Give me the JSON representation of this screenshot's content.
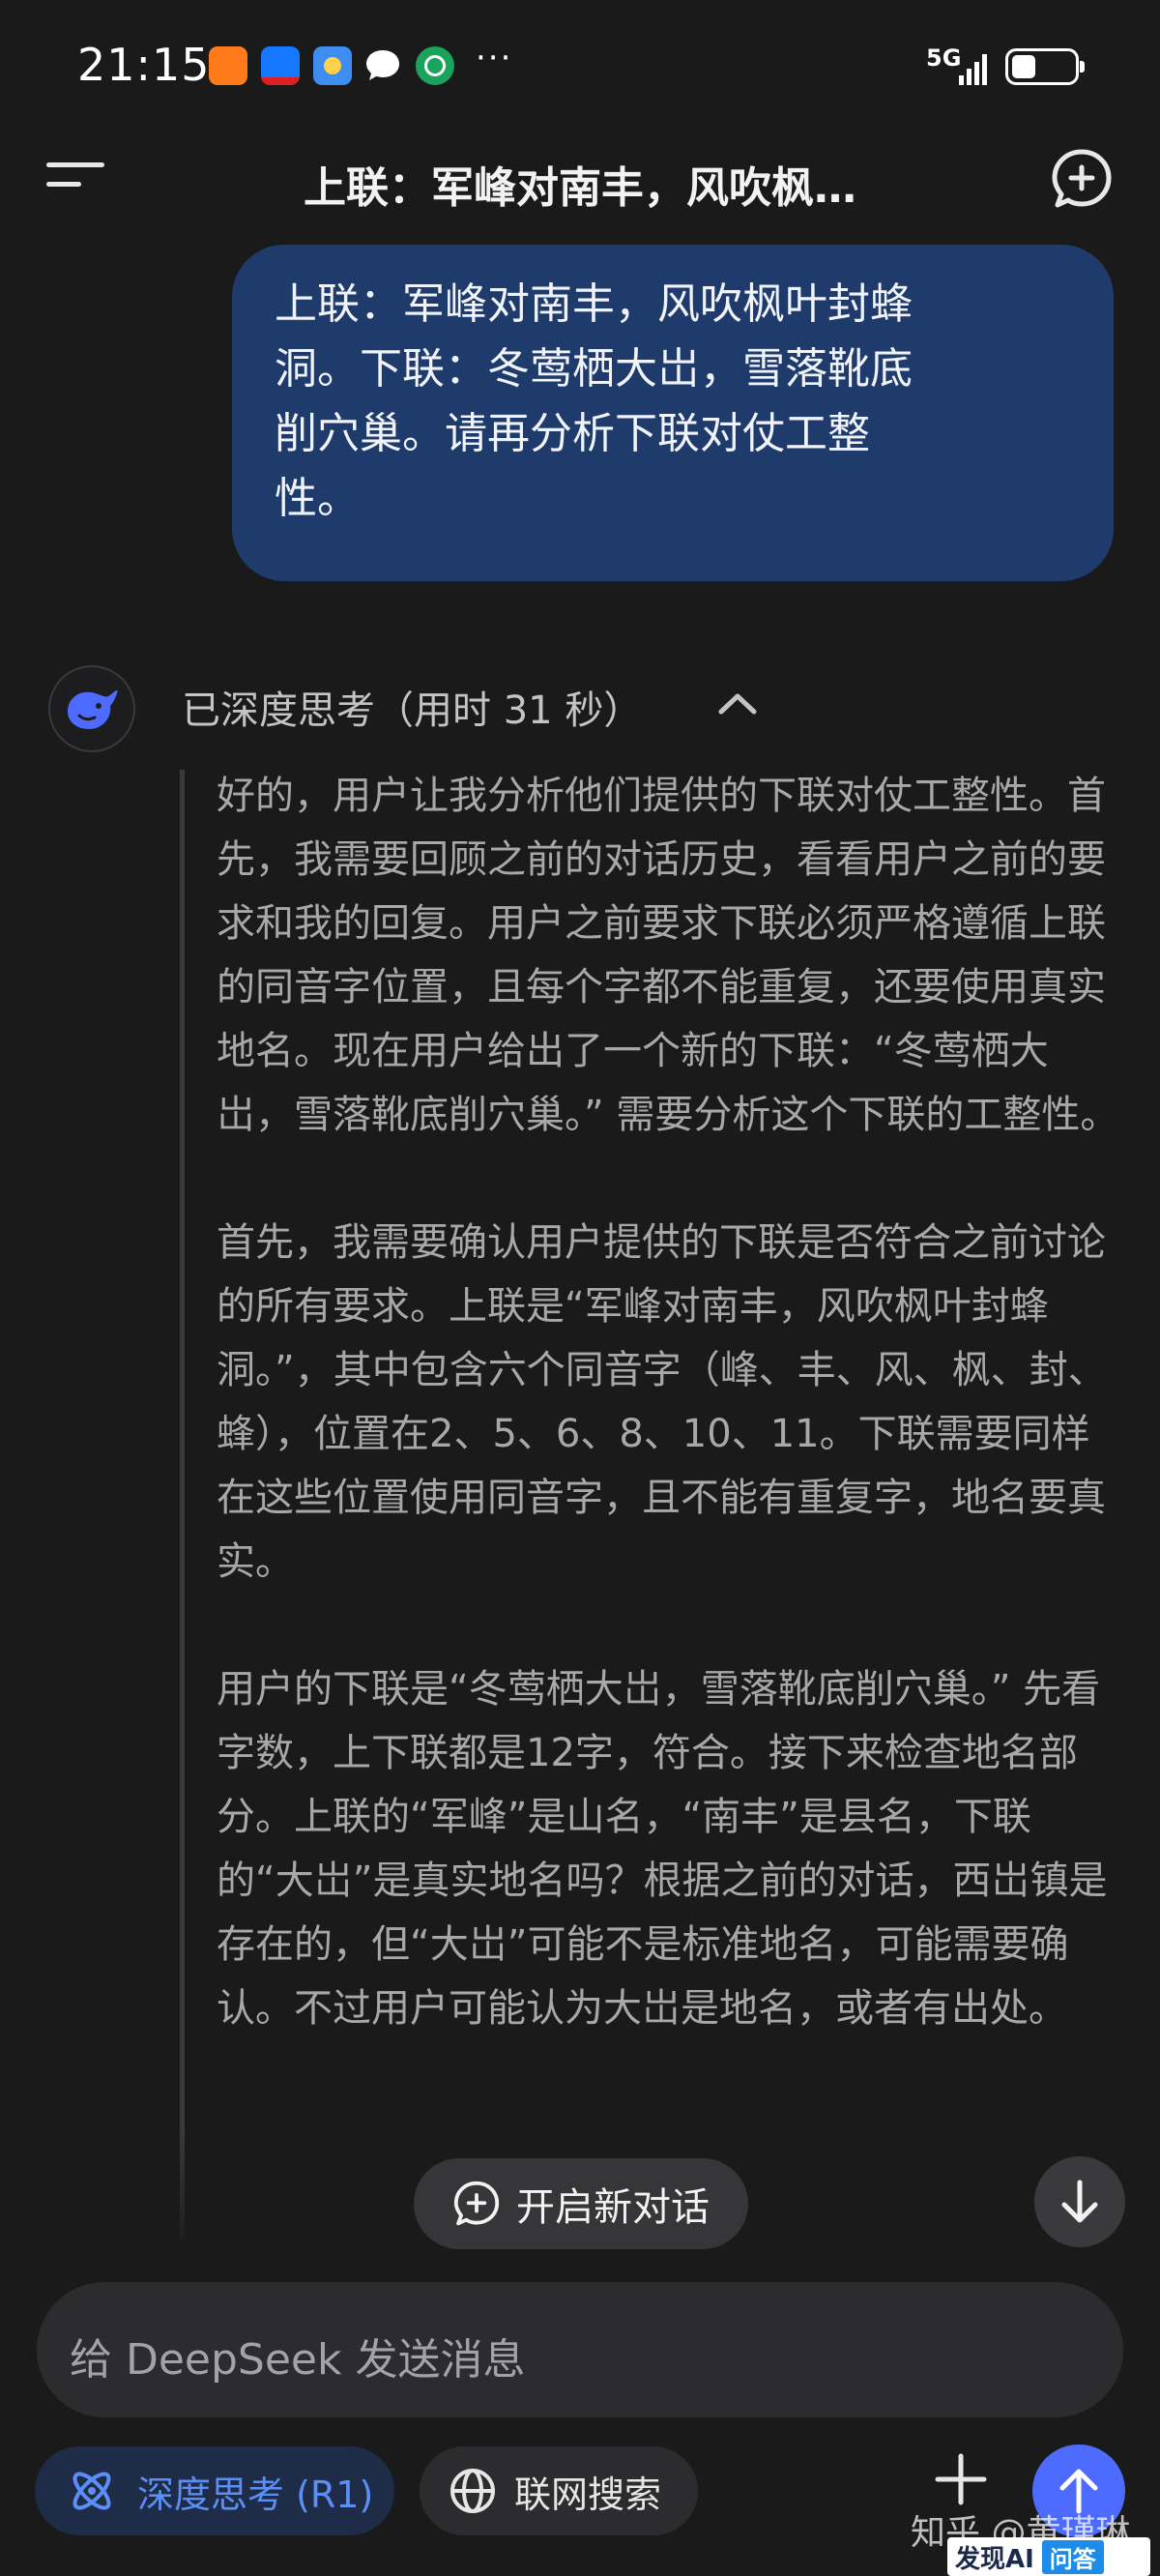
{
  "status_bar": {
    "time": "21:15",
    "network": "5G",
    "more": "···"
  },
  "header": {
    "title": "上联：军峰对南丰，风吹枫…"
  },
  "user_message": {
    "lines": [
      "上联：军峰对南丰，风吹枫叶封蜂",
      "洞。下联：冬莺栖大岀，雪落靴底",
      "削穴巢。请再分析下联对仗工整",
      "性。"
    ]
  },
  "ai": {
    "think_header": "已深度思考（用时 31 秒）",
    "thought_paragraphs": [
      "好的，用户让我分析他们提供的下联对仗工整性。首先，我需要回顾之前的对话历史，看看用户之前的要求和我的回复。用户之前要求下联必须严格遵循上联的同音字位置，且每个字都不能重复，还要使用真实地名。现在用户给出了一个新的下联：“冬莺栖大岀，雪落靴底削穴巢。” 需要分析这个下联的工整性。",
      "首先，我需要确认用户提供的下联是否符合之前讨论的所有要求。上联是“军峰对南丰，风吹枫叶封蜂洞。”，其中包含六个同音字（峰、丰、风、枫、封、蜂），位置在2、5、6、8、10、11。下联需要同样在这些位置使用同音字，且不能有重复字，地名要真实。",
      "用户的下联是“冬莺栖大岀，雪落靴底削穴巢。” 先看字数，上下联都是12字，符合。接下来检查地名部分。上联的“军峰”是山名，“南丰”是县名，下联的“大岀”是真实地名吗？根据之前的对话，西岀镇是存在的，但“大岀”可能不是标准地名，可能需要确认。不过用户可能认为大岀是地名，或者有出处。"
    ]
  },
  "floating": {
    "new_chat_label": "开启新对话"
  },
  "composer": {
    "placeholder": "给 DeepSeek 发送消息",
    "deep_think_label": "深度思考 (R1)",
    "web_search_label": "联网搜索"
  },
  "watermark": {
    "text": "知乎 @黄瑾琳",
    "logo_text": "发现AI",
    "logo_ask": "问答"
  },
  "colors": {
    "bubble": "#1f3b6b",
    "accent": "#4d6bfe",
    "r1_text": "#5b8ff7"
  }
}
